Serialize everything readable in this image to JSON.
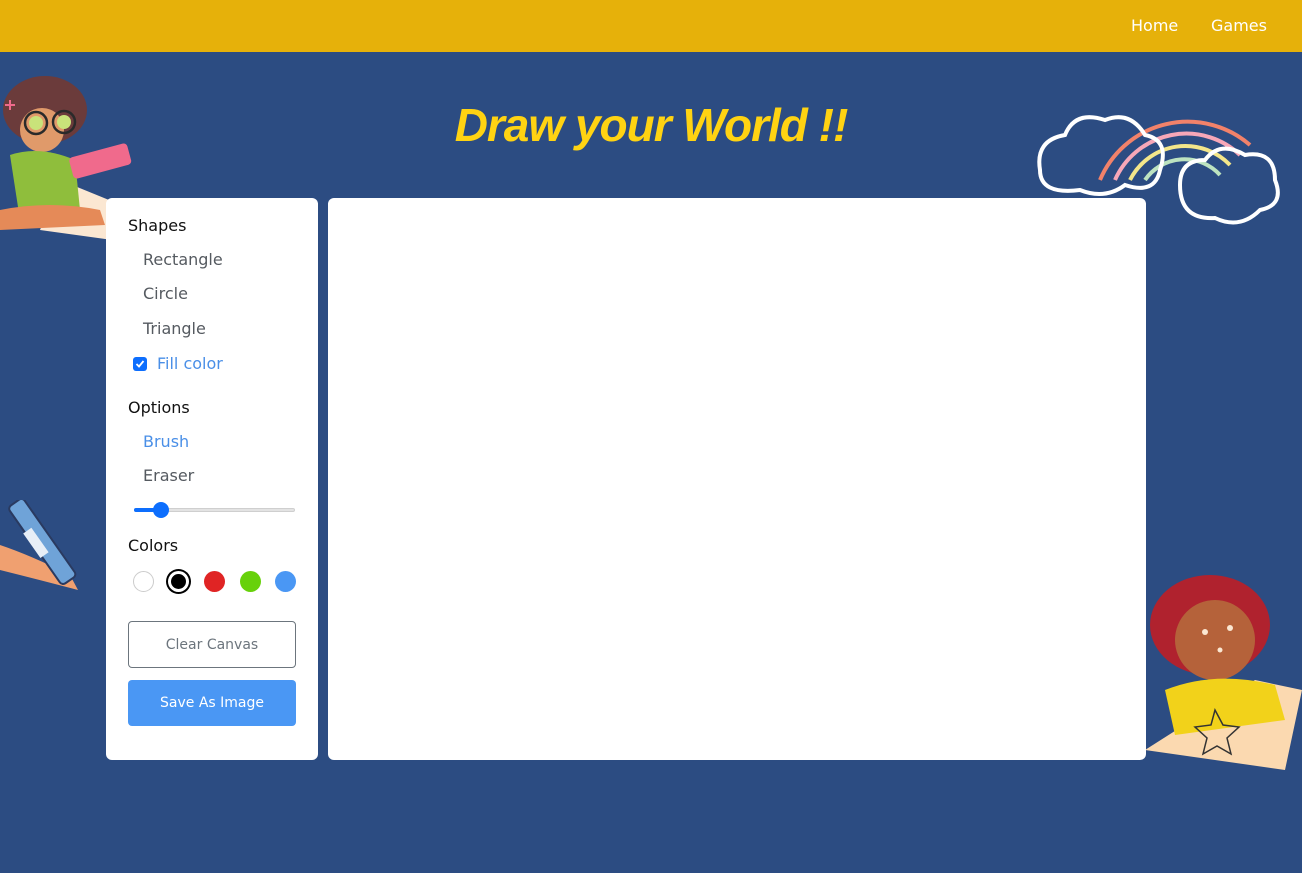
{
  "nav": {
    "home": "Home",
    "games": "Games"
  },
  "page": {
    "title": "Draw your World !!"
  },
  "tools": {
    "shapes_title": "Shapes",
    "shapes": [
      "Rectangle",
      "Circle",
      "Triangle"
    ],
    "fill_color_label": "Fill color",
    "fill_color_checked": true,
    "options_title": "Options",
    "options": [
      "Brush",
      "Eraser"
    ],
    "active_option": "Brush",
    "brush_size_fraction": 0.17,
    "colors_title": "Colors",
    "colors": [
      "#ffffff",
      "#000000",
      "#e02424",
      "#67d10b",
      "#4a97f4"
    ],
    "selected_color": "#000000",
    "clear_label": "Clear Canvas",
    "save_label": "Save As Image"
  },
  "theme": {
    "background": "#2c4c82",
    "topbar": "#e6b10a",
    "title_color": "#ffd312",
    "accent": "#4a97f4"
  },
  "decorations": [
    "girl-drawing-illustration",
    "rainbow-clouds-illustration",
    "crayon-illustration",
    "girl-with-star-illustration"
  ]
}
